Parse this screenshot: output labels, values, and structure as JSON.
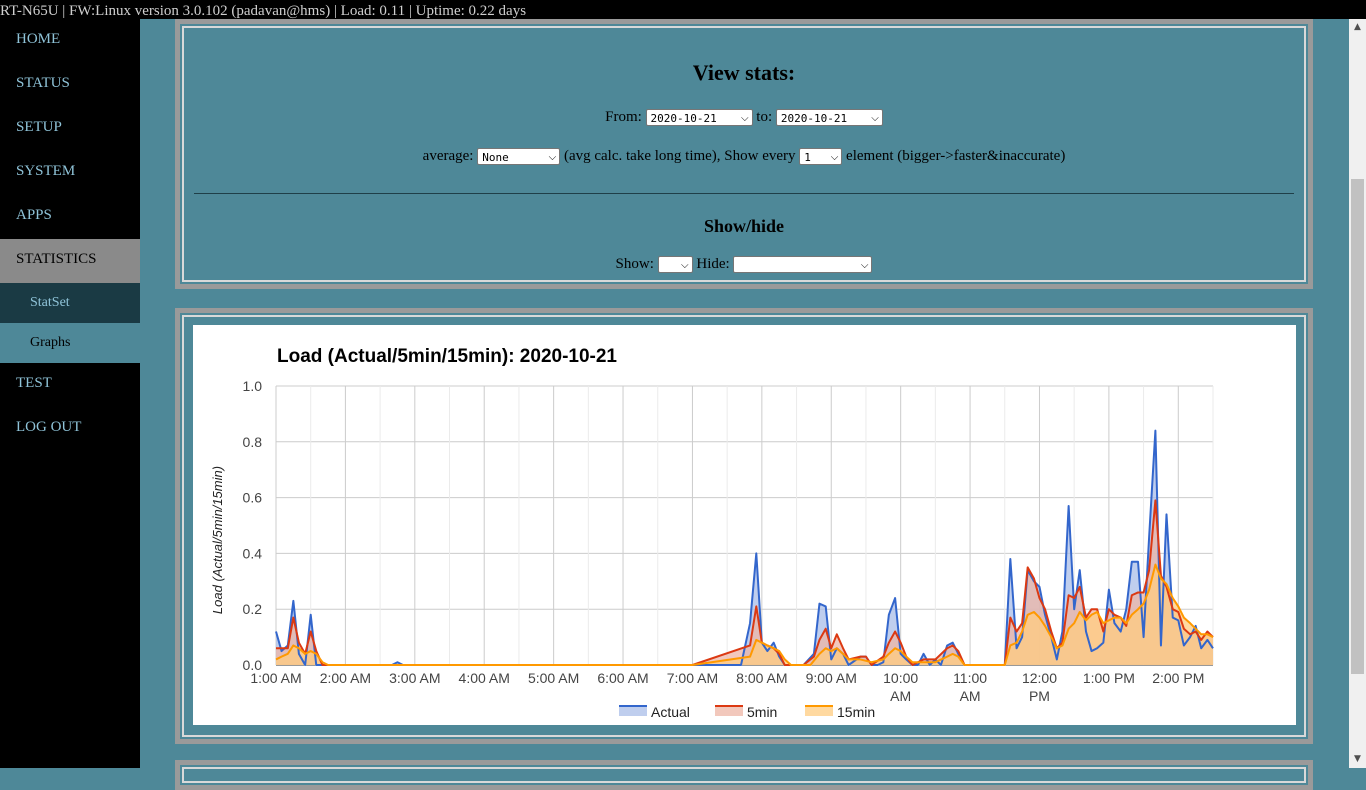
{
  "topbar": {
    "text": "RT-N65U | FW:Linux version 3.0.102 (padavan@hms) | Load: 0.11 | Uptime: 0.22 days"
  },
  "nav": {
    "items": [
      "HOME",
      "STATUS",
      "SETUP",
      "SYSTEM",
      "APPS",
      "STATISTICS"
    ],
    "sub_items": [
      "StatSet",
      "Graphs"
    ],
    "items_after": [
      "TEST",
      "LOG OUT"
    ]
  },
  "view_stats": {
    "title": "View stats:",
    "from_label": "From:",
    "from_value": "2020-10-21",
    "to_label": "to:",
    "to_value": "2020-10-21",
    "average_label": "average:",
    "average_value": "None",
    "avg_note": "(avg calc. take long time), Show every",
    "show_every_value": "1",
    "element_note": "element (bigger->faster&inaccurate)"
  },
  "show_hide": {
    "title": "Show/hide",
    "show_label": "Show:",
    "show_value": "",
    "hide_label": "Hide:",
    "hide_value": ""
  },
  "chart_data": {
    "type": "area",
    "title": "Load (Actual/5min/15min): 2020-10-21",
    "ylabel": "Load (Actual/5min/15min)",
    "xlabel": "",
    "ylim": [
      0,
      1.0
    ],
    "yticks": [
      "0.0",
      "0.2",
      "0.4",
      "0.6",
      "0.8",
      "1.0"
    ],
    "xticks": [
      "1:00 AM",
      "2:00 AM",
      "3:00 AM",
      "4:00 AM",
      "5:00 AM",
      "6:00 AM",
      "7:00 AM",
      "8:00 AM",
      "9:00 AM",
      "10:00 AM",
      "11:00 AM",
      "12:00 PM",
      "1:00 PM",
      "2:00 PM"
    ],
    "xlim_hours": [
      1.0,
      14.5
    ],
    "grid": true,
    "legend_position": "bottom",
    "series": [
      {
        "name": "Actual",
        "color": "#3366cc",
        "fill": "#a9bde8",
        "points": [
          [
            1.0,
            0.12
          ],
          [
            1.08,
            0.05
          ],
          [
            1.17,
            0.07
          ],
          [
            1.25,
            0.23
          ],
          [
            1.33,
            0.04
          ],
          [
            1.42,
            0.0
          ],
          [
            1.5,
            0.18
          ],
          [
            1.58,
            0.0
          ],
          [
            1.7,
            0.0
          ],
          [
            2.0,
            0.0
          ],
          [
            2.67,
            0.0
          ],
          [
            2.75,
            0.01
          ],
          [
            2.83,
            0.0
          ],
          [
            7.0,
            0.0
          ],
          [
            7.7,
            0.0
          ],
          [
            7.83,
            0.15
          ],
          [
            7.92,
            0.4
          ],
          [
            8.0,
            0.08
          ],
          [
            8.08,
            0.05
          ],
          [
            8.17,
            0.08
          ],
          [
            8.25,
            0.03
          ],
          [
            8.33,
            0.0
          ],
          [
            8.6,
            0.0
          ],
          [
            8.75,
            0.04
          ],
          [
            8.83,
            0.22
          ],
          [
            8.92,
            0.21
          ],
          [
            9.0,
            0.02
          ],
          [
            9.08,
            0.06
          ],
          [
            9.17,
            0.04
          ],
          [
            9.25,
            0.0
          ],
          [
            9.42,
            0.03
          ],
          [
            9.5,
            0.03
          ],
          [
            9.58,
            0.0
          ],
          [
            9.67,
            0.0
          ],
          [
            9.75,
            0.01
          ],
          [
            9.83,
            0.18
          ],
          [
            9.92,
            0.24
          ],
          [
            10.0,
            0.04
          ],
          [
            10.08,
            0.02
          ],
          [
            10.17,
            0.0
          ],
          [
            10.25,
            0.0
          ],
          [
            10.33,
            0.04
          ],
          [
            10.42,
            0.0
          ],
          [
            10.5,
            0.02
          ],
          [
            10.58,
            0.0
          ],
          [
            10.67,
            0.07
          ],
          [
            10.75,
            0.08
          ],
          [
            10.83,
            0.04
          ],
          [
            10.92,
            0.0
          ],
          [
            11.5,
            0.0
          ],
          [
            11.58,
            0.38
          ],
          [
            11.67,
            0.06
          ],
          [
            11.75,
            0.1
          ],
          [
            11.83,
            0.34
          ],
          [
            11.92,
            0.3
          ],
          [
            12.0,
            0.28
          ],
          [
            12.08,
            0.18
          ],
          [
            12.17,
            0.1
          ],
          [
            12.25,
            0.02
          ],
          [
            12.33,
            0.12
          ],
          [
            12.42,
            0.57
          ],
          [
            12.5,
            0.2
          ],
          [
            12.58,
            0.34
          ],
          [
            12.67,
            0.12
          ],
          [
            12.75,
            0.05
          ],
          [
            12.83,
            0.06
          ],
          [
            12.92,
            0.08
          ],
          [
            13.0,
            0.27
          ],
          [
            13.08,
            0.15
          ],
          [
            13.17,
            0.12
          ],
          [
            13.25,
            0.2
          ],
          [
            13.33,
            0.37
          ],
          [
            13.42,
            0.37
          ],
          [
            13.5,
            0.1
          ],
          [
            13.58,
            0.46
          ],
          [
            13.67,
            0.84
          ],
          [
            13.75,
            0.07
          ],
          [
            13.83,
            0.54
          ],
          [
            13.92,
            0.17
          ],
          [
            14.0,
            0.16
          ],
          [
            14.08,
            0.07
          ],
          [
            14.17,
            0.1
          ],
          [
            14.25,
            0.14
          ],
          [
            14.33,
            0.06
          ],
          [
            14.42,
            0.09
          ],
          [
            14.5,
            0.06
          ]
        ]
      },
      {
        "name": "5min",
        "color": "#dc3912",
        "fill": "#eeb5a6",
        "points": [
          [
            1.0,
            0.06
          ],
          [
            1.08,
            0.06
          ],
          [
            1.17,
            0.06
          ],
          [
            1.25,
            0.17
          ],
          [
            1.33,
            0.08
          ],
          [
            1.42,
            0.04
          ],
          [
            1.5,
            0.12
          ],
          [
            1.58,
            0.05
          ],
          [
            1.67,
            0.0
          ],
          [
            2.0,
            0.0
          ],
          [
            7.0,
            0.0
          ],
          [
            7.83,
            0.07
          ],
          [
            7.92,
            0.21
          ],
          [
            8.0,
            0.08
          ],
          [
            8.08,
            0.07
          ],
          [
            8.17,
            0.06
          ],
          [
            8.25,
            0.04
          ],
          [
            8.33,
            0.0
          ],
          [
            8.6,
            0.0
          ],
          [
            8.75,
            0.03
          ],
          [
            8.83,
            0.09
          ],
          [
            8.92,
            0.13
          ],
          [
            9.0,
            0.06
          ],
          [
            9.08,
            0.11
          ],
          [
            9.17,
            0.06
          ],
          [
            9.25,
            0.02
          ],
          [
            9.42,
            0.03
          ],
          [
            9.5,
            0.03
          ],
          [
            9.58,
            0.0
          ],
          [
            9.75,
            0.03
          ],
          [
            9.83,
            0.08
          ],
          [
            9.92,
            0.12
          ],
          [
            10.0,
            0.08
          ],
          [
            10.08,
            0.03
          ],
          [
            10.17,
            0.0
          ],
          [
            10.33,
            0.02
          ],
          [
            10.5,
            0.02
          ],
          [
            10.67,
            0.06
          ],
          [
            10.75,
            0.07
          ],
          [
            10.83,
            0.05
          ],
          [
            10.92,
            0.0
          ],
          [
            11.5,
            0.0
          ],
          [
            11.58,
            0.17
          ],
          [
            11.67,
            0.12
          ],
          [
            11.75,
            0.15
          ],
          [
            11.83,
            0.35
          ],
          [
            11.92,
            0.31
          ],
          [
            12.0,
            0.24
          ],
          [
            12.08,
            0.2
          ],
          [
            12.17,
            0.12
          ],
          [
            12.25,
            0.06
          ],
          [
            12.33,
            0.08
          ],
          [
            12.42,
            0.25
          ],
          [
            12.5,
            0.24
          ],
          [
            12.58,
            0.28
          ],
          [
            12.67,
            0.17
          ],
          [
            12.75,
            0.2
          ],
          [
            12.83,
            0.2
          ],
          [
            12.92,
            0.12
          ],
          [
            13.0,
            0.2
          ],
          [
            13.08,
            0.18
          ],
          [
            13.17,
            0.17
          ],
          [
            13.25,
            0.14
          ],
          [
            13.33,
            0.25
          ],
          [
            13.42,
            0.26
          ],
          [
            13.5,
            0.26
          ],
          [
            13.58,
            0.34
          ],
          [
            13.67,
            0.59
          ],
          [
            13.75,
            0.32
          ],
          [
            13.83,
            0.28
          ],
          [
            13.92,
            0.2
          ],
          [
            14.0,
            0.19
          ],
          [
            14.08,
            0.13
          ],
          [
            14.17,
            0.11
          ],
          [
            14.25,
            0.12
          ],
          [
            14.33,
            0.09
          ],
          [
            14.42,
            0.12
          ],
          [
            14.5,
            0.1
          ]
        ]
      },
      {
        "name": "15min",
        "color": "#ff9900",
        "fill": "#ffcc80",
        "points": [
          [
            1.0,
            0.02
          ],
          [
            1.08,
            0.03
          ],
          [
            1.17,
            0.04
          ],
          [
            1.25,
            0.07
          ],
          [
            1.33,
            0.06
          ],
          [
            1.42,
            0.04
          ],
          [
            1.5,
            0.05
          ],
          [
            1.58,
            0.04
          ],
          [
            1.67,
            0.01
          ],
          [
            1.75,
            0.0
          ],
          [
            7.0,
            0.0
          ],
          [
            7.83,
            0.03
          ],
          [
            7.92,
            0.09
          ],
          [
            8.0,
            0.08
          ],
          [
            8.08,
            0.07
          ],
          [
            8.17,
            0.06
          ],
          [
            8.25,
            0.05
          ],
          [
            8.33,
            0.02
          ],
          [
            8.42,
            0.0
          ],
          [
            8.7,
            0.0
          ],
          [
            8.83,
            0.04
          ],
          [
            8.92,
            0.06
          ],
          [
            9.0,
            0.05
          ],
          [
            9.08,
            0.06
          ],
          [
            9.17,
            0.04
          ],
          [
            9.25,
            0.02
          ],
          [
            9.42,
            0.02
          ],
          [
            9.58,
            0.01
          ],
          [
            9.75,
            0.02
          ],
          [
            9.83,
            0.04
          ],
          [
            9.92,
            0.06
          ],
          [
            10.0,
            0.05
          ],
          [
            10.08,
            0.03
          ],
          [
            10.17,
            0.01
          ],
          [
            10.33,
            0.01
          ],
          [
            10.5,
            0.01
          ],
          [
            10.67,
            0.03
          ],
          [
            10.75,
            0.04
          ],
          [
            10.83,
            0.03
          ],
          [
            10.92,
            0.0
          ],
          [
            11.5,
            0.0
          ],
          [
            11.58,
            0.07
          ],
          [
            11.67,
            0.08
          ],
          [
            11.75,
            0.12
          ],
          [
            11.83,
            0.18
          ],
          [
            11.92,
            0.19
          ],
          [
            12.0,
            0.17
          ],
          [
            12.08,
            0.14
          ],
          [
            12.17,
            0.1
          ],
          [
            12.25,
            0.06
          ],
          [
            12.33,
            0.07
          ],
          [
            12.42,
            0.13
          ],
          [
            12.5,
            0.15
          ],
          [
            12.58,
            0.19
          ],
          [
            12.67,
            0.16
          ],
          [
            12.75,
            0.18
          ],
          [
            12.83,
            0.19
          ],
          [
            12.92,
            0.15
          ],
          [
            13.0,
            0.16
          ],
          [
            13.08,
            0.17
          ],
          [
            13.17,
            0.17
          ],
          [
            13.25,
            0.15
          ],
          [
            13.33,
            0.18
          ],
          [
            13.42,
            0.2
          ],
          [
            13.5,
            0.22
          ],
          [
            13.58,
            0.27
          ],
          [
            13.67,
            0.36
          ],
          [
            13.75,
            0.31
          ],
          [
            13.83,
            0.29
          ],
          [
            13.92,
            0.24
          ],
          [
            14.0,
            0.21
          ],
          [
            14.08,
            0.17
          ],
          [
            14.17,
            0.15
          ],
          [
            14.25,
            0.13
          ],
          [
            14.33,
            0.11
          ],
          [
            14.42,
            0.11
          ],
          [
            14.5,
            0.1
          ]
        ]
      }
    ]
  },
  "scrollbar": {
    "up_arrow": "▲",
    "down_arrow": "▼"
  }
}
